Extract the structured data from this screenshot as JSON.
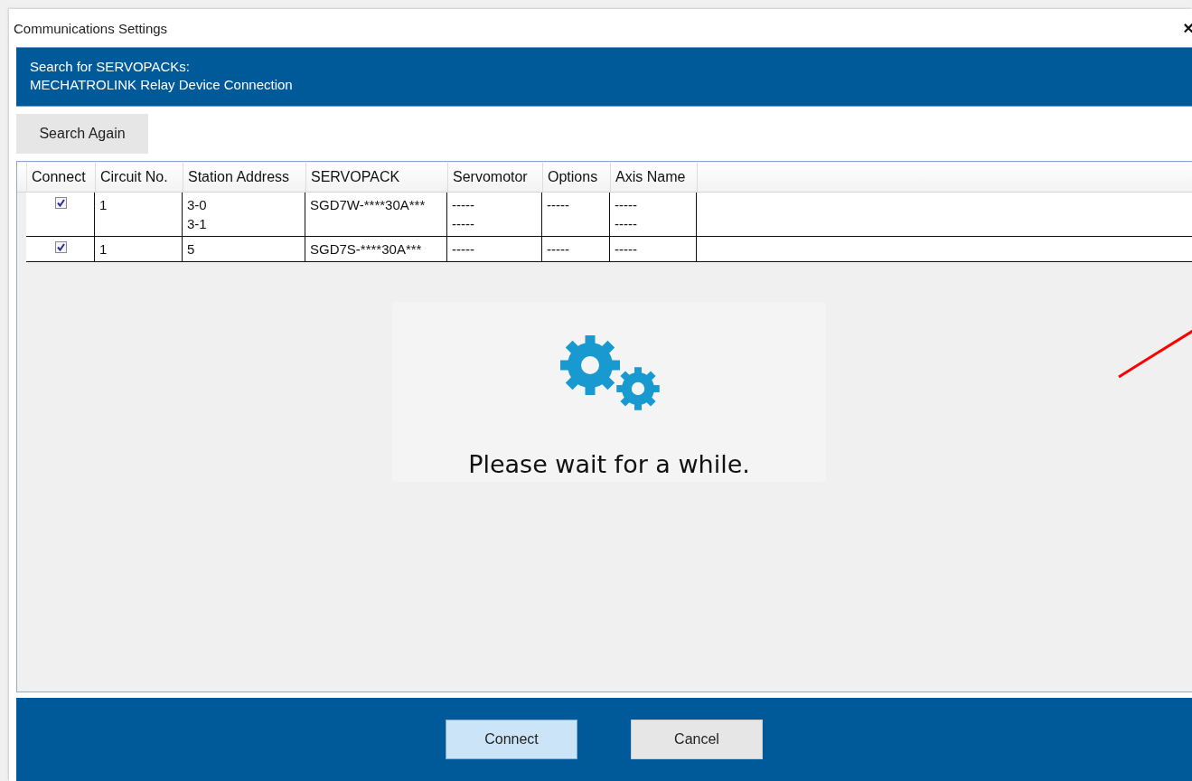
{
  "window": {
    "title": "Communications Settings",
    "close": "×"
  },
  "header": {
    "lines": [
      "Search for SERVOPACKs:",
      "MECHATROLINK Relay Device Connection"
    ]
  },
  "search_button": "Search Again",
  "table": {
    "columns": [
      "Connect",
      "Circuit No.",
      "Station Address",
      "SERVOPACK",
      "Servomotor",
      "Options",
      "Axis Name"
    ],
    "rows": [
      {
        "checked": true,
        "cells": [
          "",
          "1",
          "3-0\n3-1",
          "SGD7W-****30A***",
          "-----\n-----",
          "-----",
          "-----\n-----"
        ]
      },
      {
        "checked": true,
        "cells": [
          "",
          "1",
          "5",
          "SGD7S-****30A***",
          "-----",
          "-----",
          "-----"
        ]
      }
    ]
  },
  "wait": {
    "message": "Please wait for a while."
  },
  "buttons": [
    {
      "label": "Connect",
      "default": true
    },
    {
      "label": "Cancel",
      "default": false
    }
  ]
}
